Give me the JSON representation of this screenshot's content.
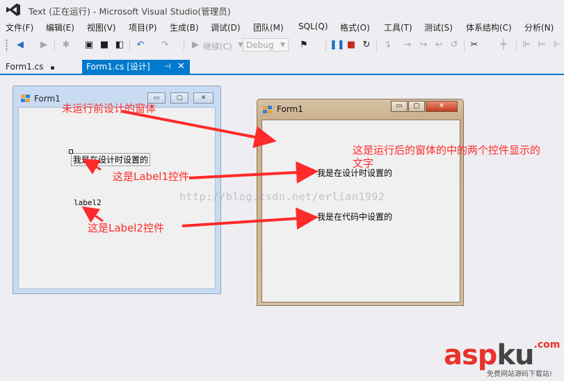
{
  "window": {
    "title": "Text (正在运行) - Microsoft Visual Studio(管理员)"
  },
  "menu": [
    "文件(F)",
    "编辑(E)",
    "视图(V)",
    "项目(P)",
    "生成(B)",
    "调试(D)",
    "团队(M)",
    "SQL(Q)",
    "格式(O)",
    "工具(T)",
    "测试(S)",
    "体系结构(C)",
    "分析(N)"
  ],
  "toolbar": {
    "continue_label": "继续(C)",
    "config_value": "Debug"
  },
  "tabs": {
    "inactive": "Form1.cs",
    "active": "Form1.cs [设计]"
  },
  "design_form": {
    "caption": "Form1",
    "label1_text": "我是在设计时设置的",
    "label2_text": "label2"
  },
  "run_form": {
    "caption": "Form1",
    "label1_text": "我是在设计时设置的",
    "label2_text": "我是在代码中设置的"
  },
  "annotations": {
    "design_window": "未运行前设计的窗体",
    "run_text_line1": "这是运行后的窗体的中的两个控件显示的",
    "run_text_line2": "文字",
    "label1": "这是Label1控件",
    "label2": "这是Label2控件"
  },
  "watermark": "http://blog.csdn.net/erlian1992",
  "brand": {
    "part1": "asp",
    "part2": "ku",
    "suffix": ".com",
    "tagline": "免费网站源码下载站!"
  },
  "colors": {
    "accent": "#007acc",
    "annotation": "#ff2a2a"
  },
  "icons": [
    "visual-studio-logo-icon",
    "back-icon",
    "forward-icon",
    "new-project-icon",
    "open-icon",
    "save-icon",
    "save-all-icon",
    "undo-icon",
    "redo-icon",
    "start-icon",
    "pause-icon",
    "stop-icon",
    "restart-icon",
    "pin-icon",
    "close-icon",
    "form-icon",
    "minimize-icon",
    "maximize-icon"
  ]
}
